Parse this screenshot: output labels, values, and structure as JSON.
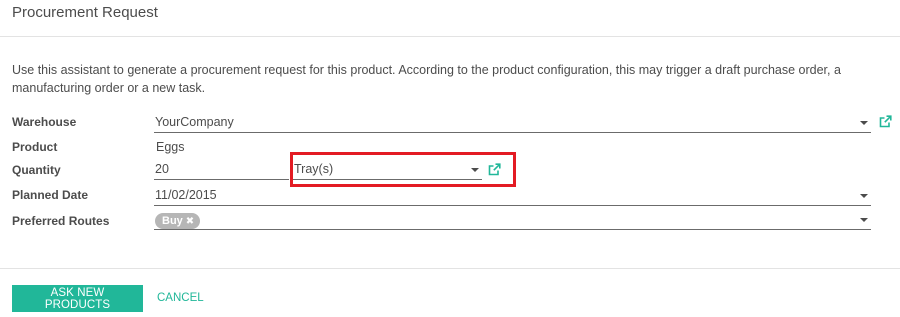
{
  "dialog": {
    "title": "Procurement Request"
  },
  "intro_text": "Use this assistant to generate a procurement request for this product. According to the product configuration, this may trigger a draft purchase order, a manufacturing order or a new task.",
  "form": {
    "warehouse": {
      "label": "Warehouse",
      "value": "YourCompany",
      "icon": "external-link-icon"
    },
    "product": {
      "label": "Product",
      "value": "Eggs"
    },
    "quantity": {
      "label": "Quantity",
      "value": "20"
    },
    "uom": {
      "value": "Tray(s)",
      "icon": "external-link-icon"
    },
    "planned_date": {
      "label": "Planned Date",
      "value": "11/02/2015"
    },
    "preferred_routes": {
      "label": "Preferred Routes",
      "tags": [
        "Buy"
      ]
    }
  },
  "buttons": {
    "primary": "ASK NEW PRODUCTS",
    "cancel": "CANCEL"
  },
  "colors": {
    "accent": "#21b799",
    "highlight": "#e31b23",
    "tag_bg": "#b6b6b6"
  }
}
